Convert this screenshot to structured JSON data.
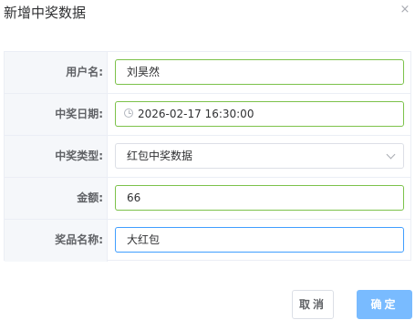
{
  "dialog": {
    "title": "新增中奖数据",
    "close_symbol": "×"
  },
  "form": {
    "username": {
      "label": "用户名:",
      "value": "刘昊然"
    },
    "win_date": {
      "label": "中奖日期:",
      "value": "2026-02-17 16:30:00"
    },
    "win_type": {
      "label": "中奖类型:",
      "value": "红包中奖数据"
    },
    "amount": {
      "label": "金额:",
      "value": "66"
    },
    "prize_name": {
      "label": "奖品名称:",
      "value": "大红包"
    }
  },
  "footer": {
    "cancel_label": "取消",
    "confirm_label": "确定"
  },
  "colors": {
    "valid_border": "#7cc24a",
    "focus_border": "#409eff",
    "primary_button": "#79bbff"
  }
}
